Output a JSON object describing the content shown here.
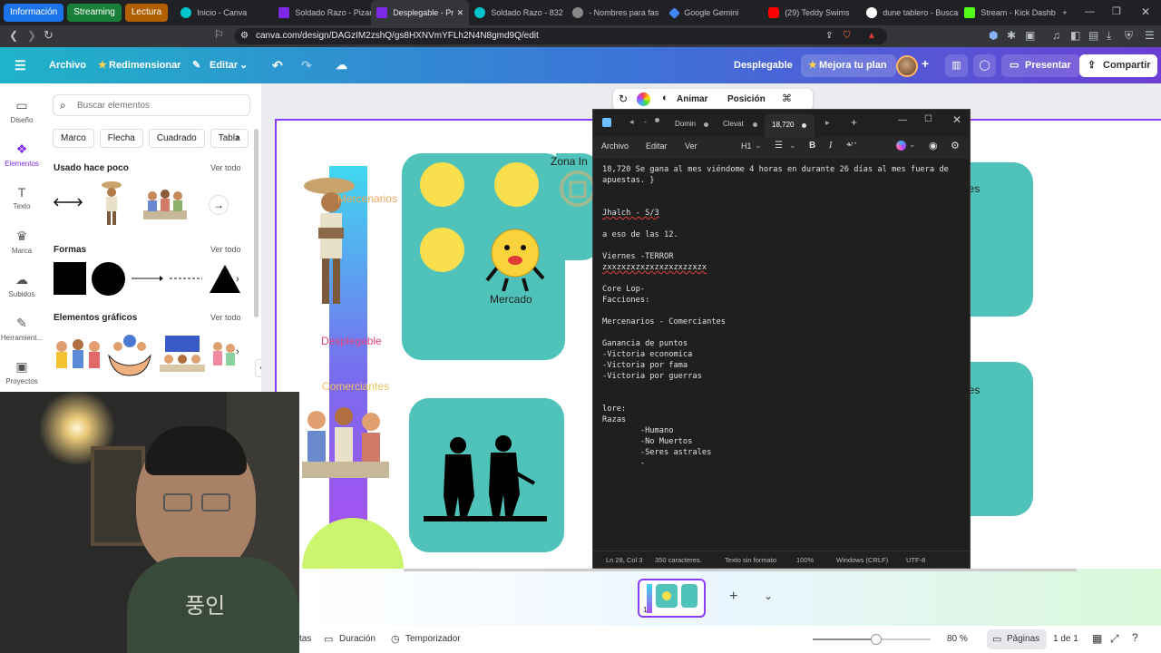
{
  "browser": {
    "tab_groups": [
      {
        "label": "Información",
        "color": "#1a73e8"
      },
      {
        "label": "Streaming",
        "color": "#188038"
      },
      {
        "label": "Lectura",
        "color": "#b06000"
      }
    ],
    "tabs": [
      {
        "title": "Inicio - Canva",
        "active": false,
        "color": "#00c4cc"
      },
      {
        "title": "Soldado Razo - Pizarr",
        "active": false,
        "color": "#7d2ae8"
      },
      {
        "title": "Desplegable - Pr",
        "active": true,
        "color": "#7d2ae8"
      },
      {
        "title": "Soldado Razo - 832",
        "active": false,
        "color": "#00c4cc"
      },
      {
        "title": "- Nombres para fas",
        "active": false,
        "color": "#888888"
      },
      {
        "title": "Google Gemini",
        "active": false,
        "color": "#4285f4"
      },
      {
        "title": "(29) Teddy Swims",
        "active": false,
        "color": "#ff0000"
      },
      {
        "title": "dune tablero - Buscar",
        "active": false,
        "color": "#ffffff"
      },
      {
        "title": "Stream - Kick Dashb",
        "active": false,
        "color": "#53fc18"
      }
    ],
    "new_tab": "+",
    "url": "canva.com/design/DAGzIM2zshQ/gs8HXNVmYFLh2N4N8gmd9Q/edit"
  },
  "canva_header": {
    "menu_icon": "☰",
    "archivo": "Archivo",
    "redimensionar": "Redimensionar",
    "editar": "Editar",
    "design_title": "Desplegable",
    "mejora": "Mejora tu plan",
    "presentar": "Presentar",
    "compartir": "Compartir"
  },
  "rail": [
    {
      "icon": "▭",
      "label": "Diseño"
    },
    {
      "icon": "❖",
      "label": "Elementos"
    },
    {
      "icon": "T",
      "label": "Texto"
    },
    {
      "icon": "♛",
      "label": "Marca"
    },
    {
      "icon": "☁",
      "label": "Subidos"
    },
    {
      "icon": "✎",
      "label": "Herramient..."
    },
    {
      "icon": "▣",
      "label": "Proyectos"
    }
  ],
  "panel": {
    "search_placeholder": "Buscar elementos",
    "chips": [
      "Marco",
      "Flecha",
      "Cuadrado",
      "Tabla"
    ],
    "recent_title": "Usado hace poco",
    "shapes_title": "Formas",
    "graphics_title": "Elementos gráficos",
    "see_all": "Ver todo"
  },
  "toolbar": {
    "animar": "Animar",
    "posicion": "Posición"
  },
  "canvas": {
    "zona": "Zona In",
    "mercado": "Mercado",
    "mercenarios": "Mercenarios",
    "desplegable": "Desplegable",
    "comerciantes": "Comerciantes",
    "right_label_1": "nes",
    "right_label_2": "nes"
  },
  "notepad": {
    "tabs": [
      "Domin",
      "Clevat",
      "18,720"
    ],
    "menu": [
      "Archivo",
      "Editar",
      "Ver"
    ],
    "heading": "H1",
    "lines": [
      "18,720 Se gana al mes viéndome 4 horas en durante 26 días al mes fuera de",
      "apuestas. }",
      "",
      "",
      "Jhalch - S/3",
      "",
      "a eso de las 12.",
      "",
      "Viernes -TERROR",
      "zxxzxzxzxzxzxzxzxzzxzx",
      "",
      "Core Lop-",
      "Facciones:",
      "",
      "Mercenarios - Comerciantes",
      "",
      "Ganancia de puntos",
      "-Victoria economica",
      "-Victoria por fama",
      "-Victoria por guerras",
      "",
      "",
      "lore:",
      "Razas",
      "        -Humano",
      "        -No Muertos",
      "        -Seres astrales",
      "        -"
    ],
    "status": {
      "position": "Ln 28, Col 3",
      "chars": "350 caracteres.",
      "format": "Texto sin formato",
      "zoom": "100%",
      "eol": "Windows (CRLF)",
      "encoding": "UTF-8"
    }
  },
  "bottom": {
    "notas": "tas",
    "duracion": "Duración",
    "temporizador": "Temporizador",
    "zoom": "80 %",
    "paginas": "Páginas",
    "page_count": "1 de 1",
    "page_thumb_number": "1"
  },
  "webcam": {
    "hoodie_text": "풍인"
  }
}
